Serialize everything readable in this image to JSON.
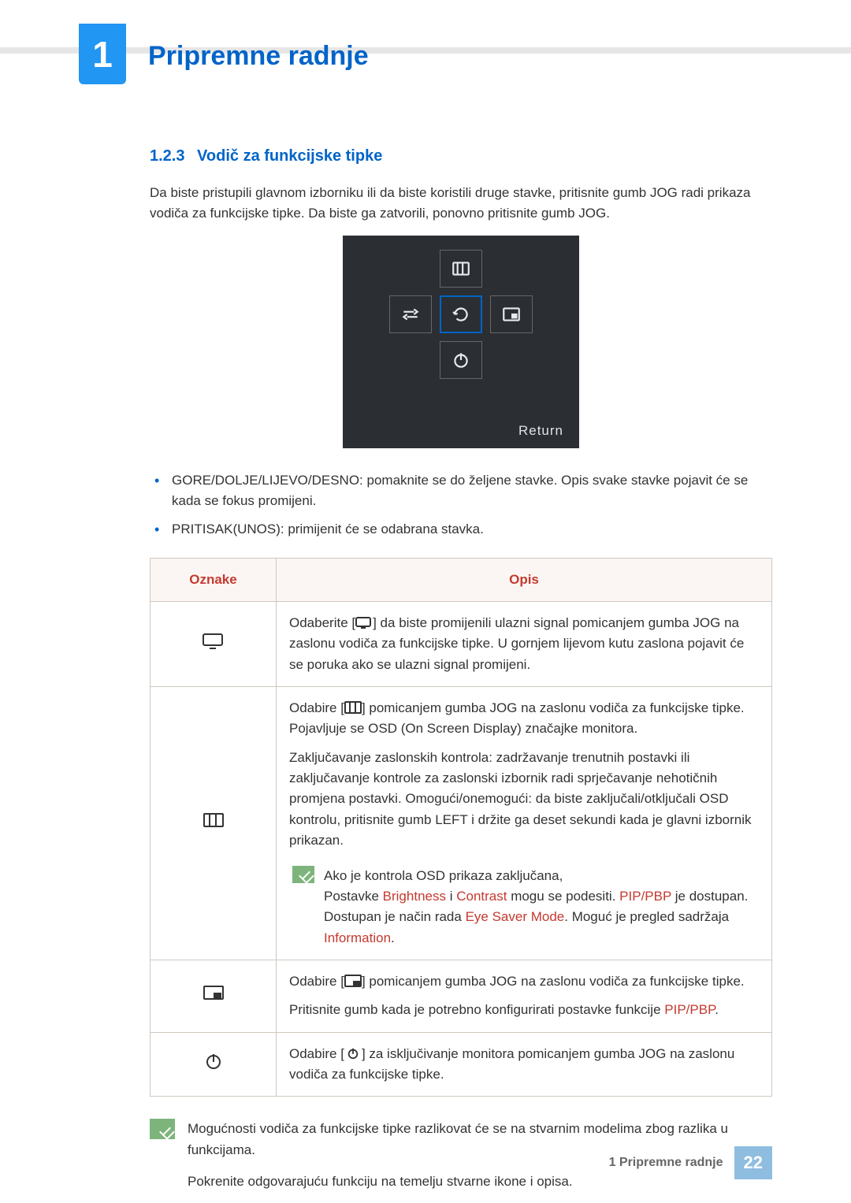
{
  "chapter": {
    "number": "1",
    "title": "Pripremne radnje"
  },
  "section": {
    "number": "1.2.3",
    "title": "Vodič za funkcijske tipke"
  },
  "intro": "Da biste pristupili glavnom izborniku ili da biste koristili druge stavke, pritisnite gumb JOG radi prikaza vodiča za funkcijske tipke. Da biste ga zatvorili, ponovno pritisnite gumb JOG.",
  "osd": {
    "return": "Return"
  },
  "bullets": [
    "GORE/DOLJE/LIJEVO/DESNO: pomaknite se do željene stavke. Opis svake stavke pojavit će se kada se fokus promijeni.",
    "PRITISAK(UNOS): primijenit će se odabrana stavka."
  ],
  "table": {
    "head": {
      "col1": "Oznake",
      "col2": "Opis"
    },
    "rows": {
      "source": {
        "pre": "Odaberite [",
        "post": "] da biste promijenili ulazni signal pomicanjem gumba JOG na zaslonu vodiča za funkcijske tipke. U gornjem lijevom kutu zaslona pojavit će se poruka ako se ulazni signal promijeni."
      },
      "menu": {
        "p1_pre": "Odabire [",
        "p1_post": "] pomicanjem gumba JOG na zaslonu vodiča za funkcijske tipke. Pojavljuje se OSD (On Screen Display) značajke monitora.",
        "p2": "Zaključavanje zaslonskih kontrola: zadržavanje trenutnih postavki ili zaključavanje kontrole za zaslonski izbornik radi sprječavanje nehotičnih promjena postavki. Omogući/onemogući: da biste zaključali/otključali OSD kontrolu, pritisnite gumb LEFT i držite ga deset sekundi kada je glavni izbornik prikazan.",
        "note_lead": "Ako je kontrola OSD prikaza zaključana,",
        "note_l2a": "Postavke ",
        "note_brightness": "Brightness",
        "note_l2b": " i ",
        "note_contrast": "Contrast",
        "note_l2c": " mogu se podesiti. ",
        "note_pip1": "PIP/PBP",
        "note_l2d": " je dostupan.",
        "note_l3a": "Dostupan je način rada ",
        "note_eye": "Eye Saver Mode",
        "note_l3b": ". Moguć je pregled sadržaja ",
        "note_info": "Information",
        "note_l3c": "."
      },
      "pip": {
        "p1_pre": "Odabire [",
        "p1_post": "] pomicanjem gumba JOG na zaslonu vodiča za funkcijske tipke.",
        "p2a": "Pritisnite gumb kada je potrebno konfigurirati postavke funkcije ",
        "p2_hl": "PIP/PBP",
        "p2b": "."
      },
      "power": {
        "pre": "Odabire [",
        "post": "] za isključivanje monitora pomicanjem gumba JOG na zaslonu vodiča za funkcijske tipke."
      }
    }
  },
  "bottom_note": {
    "l1": "Mogućnosti vodiča za funkcijske tipke razlikovat će se na stvarnim modelima zbog razlika u funkcijama.",
    "l2": "Pokrenite odgovarajuću funkciju na temelju stvarne ikone i opisa."
  },
  "footer": {
    "text": "1 Pripremne radnje",
    "page": "22"
  }
}
